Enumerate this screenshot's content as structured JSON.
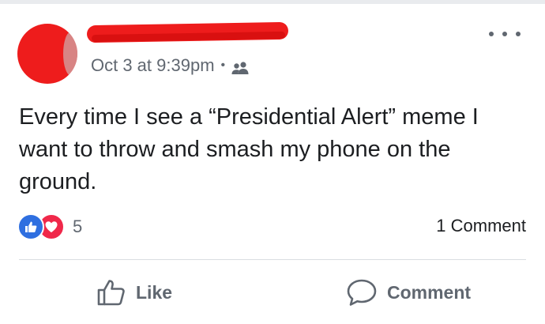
{
  "post": {
    "author_name": "",
    "timestamp": "Oct 3 at 9:39pm",
    "separator": "•",
    "audience_icon": "friends-icon",
    "more_icon": "ellipsis-icon",
    "text": "Every time I see a “Presidential Alert” meme I want to throw and smash my phone on the ground."
  },
  "engagement": {
    "reaction_icons": [
      "like-reaction-icon",
      "love-reaction-icon"
    ],
    "reaction_count": "5",
    "comment_count": "1 Comment"
  },
  "actions": {
    "like_label": "Like",
    "comment_label": "Comment"
  },
  "colors": {
    "like_blue": "#2f6fe0",
    "love_red": "#f0284a",
    "secondary_text": "#606770",
    "primary_text": "#1c1e21",
    "redaction_red": "#ee1c1c"
  }
}
